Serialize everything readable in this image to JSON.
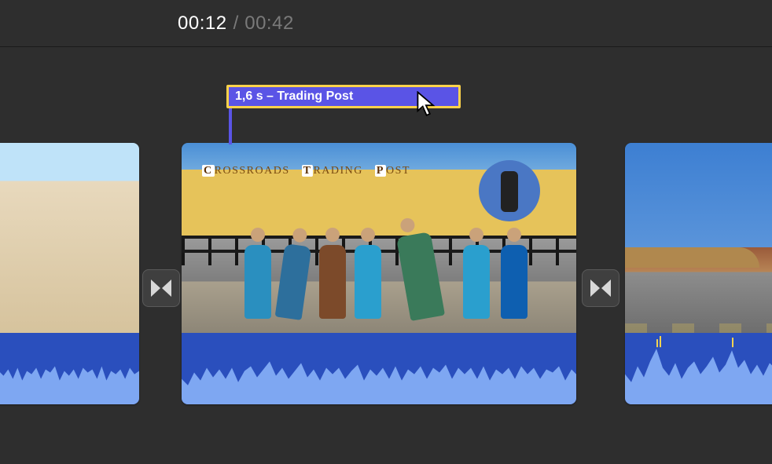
{
  "playhead": {
    "current": "00:12",
    "separator": "/",
    "total": "00:42"
  },
  "title_clip": {
    "label": "1,6 s – Trading Post"
  },
  "mid_clip_sign": {
    "letter1": "C",
    "word1": "ROSSROADS",
    "letter2": "T",
    "word2": "RADING",
    "letter3": "P",
    "word3": "OST",
    "right_letter": "P"
  },
  "icons": {
    "transition_left": "transition-icon",
    "transition_right": "transition-icon",
    "cursor": "cursor-arrow-icon"
  }
}
